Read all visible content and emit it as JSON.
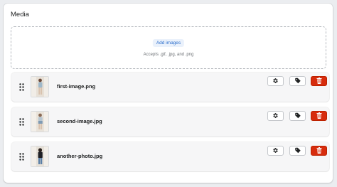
{
  "media": {
    "title": "Media",
    "dropzone": {
      "add_label": "Add images",
      "accepts": "Accepts .gif, .jpg, and .png"
    },
    "items": [
      {
        "filename": "first-image.png"
      },
      {
        "filename": "second-image.jpg"
      },
      {
        "filename": "another-photo.jpg"
      }
    ]
  },
  "icons": {
    "drag": "drag-handle-icon",
    "settings": "gear-icon",
    "tag": "tag-icon",
    "delete": "trash-icon"
  },
  "colors": {
    "accent": "#2c6ecb",
    "danger": "#d72c0d",
    "background": "#ebedf0"
  }
}
